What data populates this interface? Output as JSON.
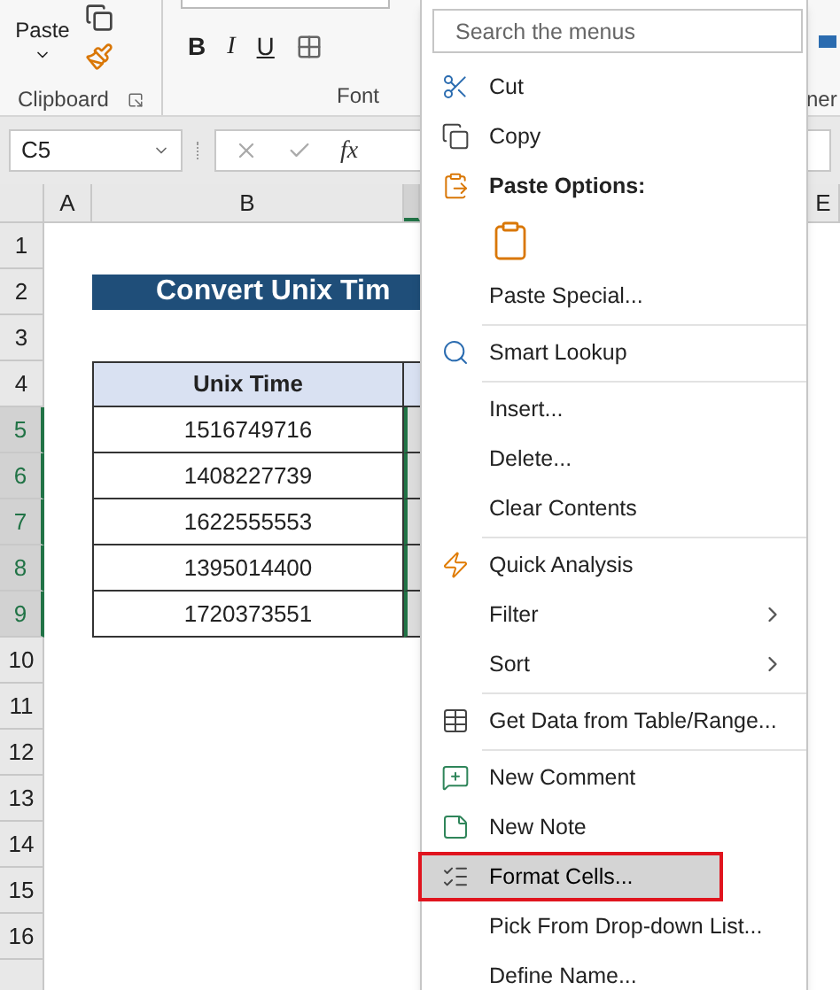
{
  "ribbon": {
    "paste_label": "Paste",
    "clipboard_label": "Clipboard",
    "font_buttons": [
      "B",
      "I",
      "U"
    ],
    "font_label": "Font",
    "cut_off_label": "ner"
  },
  "formula_bar": {
    "name_box": "C5",
    "function_label": "fx"
  },
  "columns": [
    {
      "label": "A",
      "selected": false
    },
    {
      "label": "B",
      "selected": false
    },
    {
      "selected": true
    },
    {
      "label": "E",
      "selected": false
    }
  ],
  "rows": [
    {
      "number": "1",
      "selected": false
    },
    {
      "number": "2",
      "selected": false,
      "cell": {
        "kind": "title",
        "text": "Convert Unix Tim"
      }
    },
    {
      "number": "3",
      "selected": false
    },
    {
      "number": "4",
      "selected": false,
      "cell": {
        "kind": "header",
        "text": "Unix Time"
      }
    },
    {
      "number": "5",
      "selected": true,
      "cell": {
        "kind": "value",
        "text": "1516749716"
      }
    },
    {
      "number": "6",
      "selected": true,
      "cell": {
        "kind": "value",
        "text": "1408227739"
      }
    },
    {
      "number": "7",
      "selected": true,
      "cell": {
        "kind": "value",
        "text": "1622555553"
      }
    },
    {
      "number": "8",
      "selected": true,
      "cell": {
        "kind": "value",
        "text": "1395014400"
      }
    },
    {
      "number": "9",
      "selected": true,
      "cell": {
        "kind": "value",
        "text": "1720373551"
      }
    },
    {
      "number": "10",
      "selected": false
    },
    {
      "number": "11",
      "selected": false
    },
    {
      "number": "12",
      "selected": false
    },
    {
      "number": "13",
      "selected": false
    },
    {
      "number": "14",
      "selected": false
    },
    {
      "number": "15",
      "selected": false
    },
    {
      "number": "16",
      "selected": false
    }
  ],
  "menu": {
    "search_placeholder": "Search the menus",
    "groups": [
      [
        {
          "kind": "cut",
          "label": "Cut",
          "selected": false
        },
        {
          "kind": "copy",
          "label": "Copy",
          "selected": false
        },
        {
          "kind": "paste-header",
          "label": "Paste Options:",
          "selected": false
        },
        {
          "kind": "paste-option"
        },
        {
          "kind": "item",
          "label": "Paste Special...",
          "selected": false
        }
      ],
      [
        {
          "kind": "lookup",
          "label": "Smart Lookup",
          "selected": false
        }
      ],
      [
        {
          "kind": "item",
          "label": "Insert...",
          "selected": false
        },
        {
          "kind": "item",
          "label": "Delete...",
          "selected": false
        },
        {
          "kind": "item",
          "label": "Clear Contents",
          "selected": false
        }
      ],
      [
        {
          "kind": "analysis",
          "label": "Quick Analysis",
          "selected": false
        },
        {
          "kind": "submenu",
          "label": "Filter",
          "selected": false
        },
        {
          "kind": "submenu",
          "label": "Sort",
          "selected": false
        }
      ],
      [
        {
          "kind": "table",
          "label": "Get Data from Table/Range...",
          "selected": false
        }
      ],
      [
        {
          "kind": "comment",
          "label": "New Comment",
          "selected": false
        },
        {
          "kind": "note",
          "label": "New Note",
          "selected": false
        },
        {
          "kind": "format",
          "label": "Format Cells...",
          "selected": true
        },
        {
          "kind": "item",
          "label": "Pick From Drop-down List...",
          "selected": false
        },
        {
          "kind": "item",
          "label": "Define Name...",
          "selected": false
        }
      ]
    ]
  }
}
